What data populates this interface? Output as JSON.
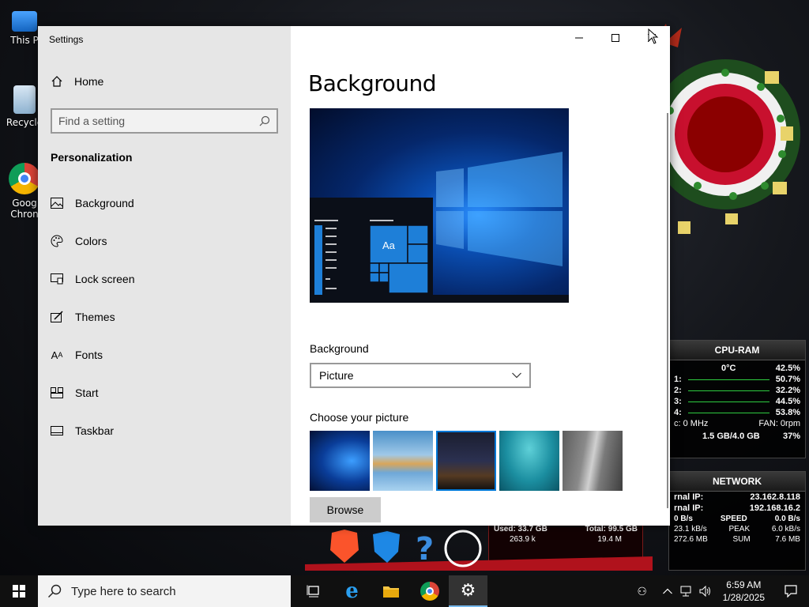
{
  "desktop": {
    "icons": [
      {
        "label": "This P"
      },
      {
        "label": "Recycle"
      },
      {
        "label": "Goog Chron"
      }
    ]
  },
  "gadgets": {
    "cpu_ram": {
      "title": "CPU-RAM",
      "temp": "0°C",
      "total": "42.5%",
      "cores": [
        {
          "name": "1:",
          "value": "50.7%"
        },
        {
          "name": "2:",
          "value": "32.2%"
        },
        {
          "name": "3:",
          "value": "44.5%"
        },
        {
          "name": "4:",
          "value": "53.8%"
        }
      ],
      "freq": "c: 0 MHz",
      "fan": "FAN: 0rpm",
      "mem": "1.5 GB/4.0 GB",
      "mem_pct": "37%"
    },
    "network": {
      "title": "NETWORK",
      "external_label": "rnal IP:",
      "external_ip": "23.162.8.118",
      "internal_label": "rnal IP:",
      "internal_ip": "192.168.16.2",
      "speed_in": "0 B/s",
      "speed_label": "SPEED",
      "speed_out": "0.0 B/s",
      "peak_in": "23.1 kB/s",
      "peak_label": "PEAK",
      "peak_out": "6.0 kB/s",
      "sum_in": "272.6 MB",
      "sum_label": "SUM",
      "sum_out": "7.6 MB"
    },
    "disk": {
      "used": "Used: 33.7 GB",
      "total": "Total: 99.5 GB",
      "read": "263.9 k",
      "write": "19.4 M"
    }
  },
  "window": {
    "title": "Settings",
    "home_label": "Home",
    "search_placeholder": "Find a setting",
    "section_title": "Personalization",
    "nav_items": [
      {
        "label": "Background",
        "icon": "image-icon"
      },
      {
        "label": "Colors",
        "icon": "palette-icon"
      },
      {
        "label": "Lock screen",
        "icon": "lock-screen-icon"
      },
      {
        "label": "Themes",
        "icon": "themes-icon"
      },
      {
        "label": "Fonts",
        "icon": "fonts-icon"
      },
      {
        "label": "Start",
        "icon": "start-icon"
      },
      {
        "label": "Taskbar",
        "icon": "taskbar-icon"
      }
    ],
    "page_title": "Background",
    "preview_sample": "Aa",
    "background_label": "Background",
    "background_value": "Picture",
    "choose_label": "Choose your picture",
    "browse_label": "Browse"
  },
  "taskbar": {
    "search_placeholder": "Type here to search",
    "time": "6:59 AM",
    "date": "1/28/2025"
  },
  "colors": {
    "accent": "#0078d7",
    "sidebar_bg": "#e6e6e6",
    "taskbar_bg": "#101010",
    "gadget_green": "#2ecc40"
  }
}
